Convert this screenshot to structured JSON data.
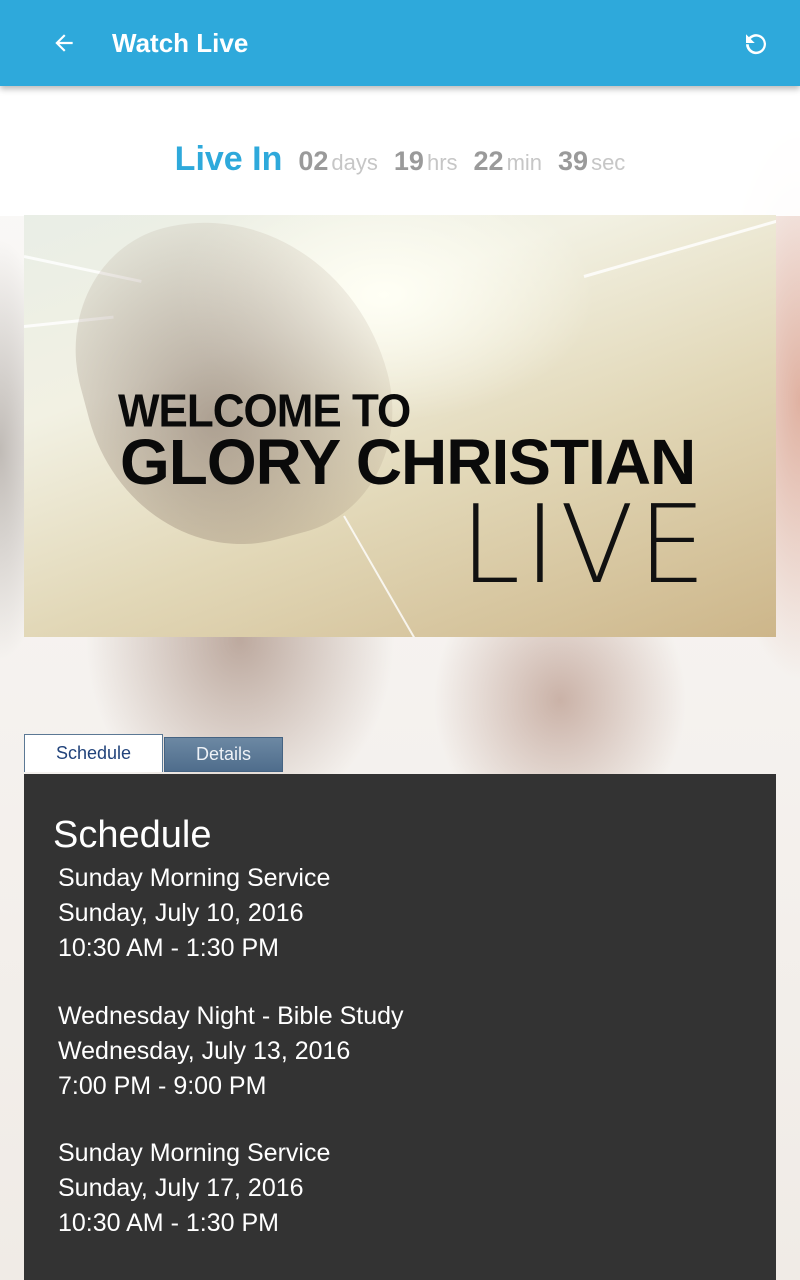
{
  "appbar": {
    "title": "Watch Live",
    "back_icon": "arrow-left-icon",
    "refresh_icon": "refresh-icon",
    "color": "#2ea9db"
  },
  "countdown": {
    "label": "Live In",
    "days": "02",
    "days_unit": "days",
    "hours": "19",
    "hours_unit": "hrs",
    "minutes": "22",
    "minutes_unit": "min",
    "seconds": "39",
    "seconds_unit": "sec"
  },
  "banner": {
    "line1": "WELCOME TO",
    "line2": "GLORY CHRISTIAN",
    "line3": "LIVE"
  },
  "tabs": [
    {
      "label": "Schedule",
      "active": true
    },
    {
      "label": "Details",
      "active": false
    }
  ],
  "schedule": {
    "title": "Schedule",
    "events": [
      {
        "name": "Sunday Morning Service",
        "date": "Sunday, July 10, 2016",
        "time": "10:30 AM - 1:30 PM"
      },
      {
        "name": "Wednesday Night - Bible Study",
        "date": "Wednesday, July 13, 2016",
        "time": "7:00 PM - 9:00 PM"
      },
      {
        "name": "Sunday Morning Service",
        "date": "Sunday, July 17, 2016",
        "time": "10:30 AM - 1:30 PM"
      }
    ]
  }
}
